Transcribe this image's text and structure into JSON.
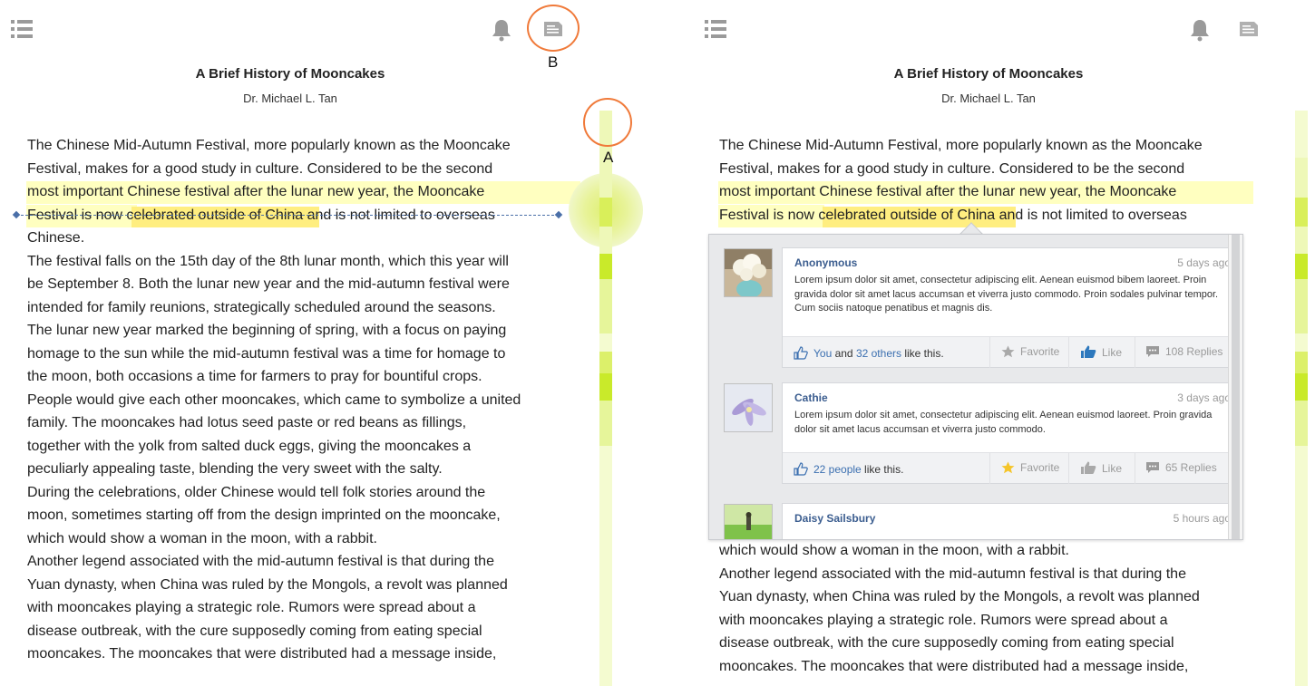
{
  "left": {
    "title": "A Brief History of Mooncakes",
    "author": "Dr. Michael L. Tan",
    "paragraph_lines": [
      "The Chinese Mid-Autumn Festival, more popularly known as the Mooncake",
      "Festival, makes for a good study in culture. Considered to be the second",
      "most important Chinese festival after the lunar new year, the Mooncake",
      "Festival is now celebrated outside of China and is not limited to overseas",
      "Chinese.",
      "The festival falls on the 15th day of the 8th lunar month, which this year will",
      "be September 8.  Both the lunar new year and the mid-autumn festival were",
      "intended for family reunions, strategically scheduled around the seasons.",
      "The lunar new year marked the beginning of spring, with a focus on paying",
      "homage to the sun while the mid-autumn festival was a time for homage to",
      "the moon, both occasions a time for farmers to pray for bountiful crops.",
      "People would give each other mooncakes, which came to symbolize a united",
      "family.  The mooncakes had lotus seed paste or red beans as fillings,",
      "together with the yolk from salted duck eggs, giving the mooncakes a",
      "peculiarly appealing taste, blending the very sweet with the salty.",
      "During the celebrations, older Chinese would tell folk stories around the",
      "moon, sometimes starting off from the design imprinted on the mooncake,",
      "which would show a woman in the moon, with a rabbit.",
      "Another legend associated with the mid-autumn festival is that during the",
      "Yuan dynasty, when China was ruled by the Mongols, a revolt was planned",
      "with mooncakes playing a strategic role.  Rumors were spread about a",
      "disease outbreak, with the cure supposedly coming from eating special",
      "mooncakes.  The mooncakes that were distributed had a message inside,"
    ],
    "annotation_a": "A",
    "annotation_b": "B"
  },
  "right": {
    "title": "A Brief History of Mooncakes",
    "author": "Dr. Michael L. Tan",
    "top_lines": [
      "The Chinese Mid-Autumn Festival, more popularly known as the Mooncake",
      "Festival, makes for a good study in culture. Considered to be the second",
      "most important Chinese festival after the lunar new year, the Mooncake",
      "Festival is now celebrated outside of China and is not limited to overseas"
    ],
    "bottom_lines": [
      "which would show a woman in the moon, with a rabbit.",
      "Another legend associated with the mid-autumn festival is that during the",
      "Yuan dynasty, when China was ruled by the Mongols, a revolt was planned",
      "with mooncakes playing a strategic role.  Rumors were spread about a",
      "disease outbreak, with the cure supposedly coming from eating special",
      "mooncakes.  The mooncakes that were distributed had a message inside,"
    ]
  },
  "comments": [
    {
      "author": "Anonymous",
      "time": "5 days ago",
      "text": "Lorem ipsum dolor sit amet, consectetur adipiscing elit. Aenean euismod bibem laoreet. Proin gravida dolor sit amet lacus accumsan et viverra justo commodo. Proin sodales pulvinar tempor. Cum sociis natoque penatibus et magnis dis.",
      "likes_prefix": "You",
      "likes_and": " and ",
      "likes_link": "32 others",
      "likes_suffix": " like this.",
      "favorite": "Favorite",
      "like": "Like",
      "replies": "108 Replies",
      "favorited": false
    },
    {
      "author": "Cathie",
      "time": "3 days ago",
      "text": "Lorem ipsum dolor sit amet, consectetur adipiscing elit. Aenean euismod laoreet. Proin gravida dolor sit amet lacus accumsan et viverra justo commodo.",
      "likes_prefix": "",
      "likes_and": "",
      "likes_link": "22 people",
      "likes_suffix": " like this.",
      "favorite": "Favorite",
      "like": "Like",
      "replies": "65 Replies",
      "favorited": true
    },
    {
      "author": "Daisy Sailsbury",
      "time": "5 hours ago"
    }
  ],
  "colors": {
    "highlight_light": "#ffffc0",
    "highlight_strong": "#ffee80",
    "annotation": "#f07a3a",
    "link": "#3b6fb0",
    "scroll_light": "#f4fbd0",
    "scroll_mid": "#e6f59a",
    "scroll_strong": "#c9ea2a"
  },
  "icons": [
    "menu-icon",
    "bell-icon",
    "document-icon",
    "thumbs-up-icon",
    "star-icon",
    "like-icon",
    "replies-icon"
  ]
}
